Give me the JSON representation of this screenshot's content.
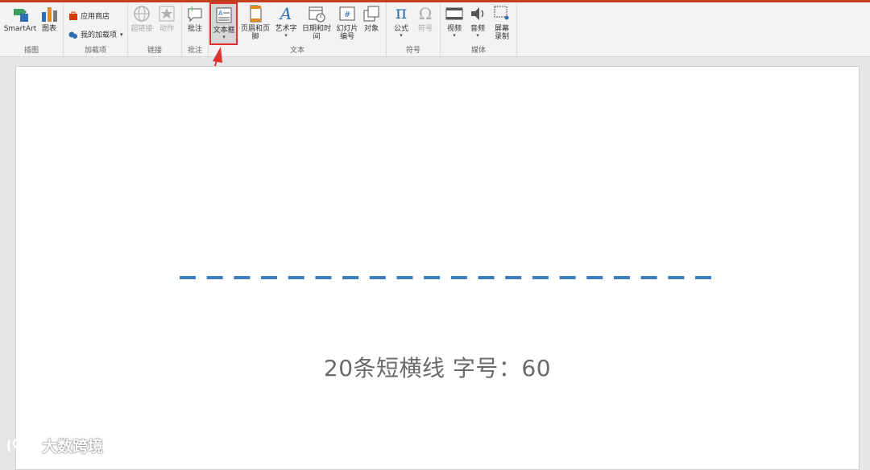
{
  "ribbon": {
    "groups": {
      "illustrations": {
        "label": "插图",
        "smartart": "SmartArt",
        "chart": "图表"
      },
      "addins": {
        "label": "加载项",
        "store": "应用商店",
        "my_addins": "我的加载项"
      },
      "links": {
        "label": "链接",
        "hyperlink": "超链接",
        "action": "动作"
      },
      "comments": {
        "label": "批注",
        "comment": "批注"
      },
      "text": {
        "label": "文本",
        "textbox": "文本框",
        "header_footer": "页眉和页脚",
        "wordart": "艺术字",
        "datetime": "日期和时间",
        "slide_number_1": "幻灯片",
        "slide_number_2": "编号",
        "object": "对象"
      },
      "symbols": {
        "label": "符号",
        "equation": "公式",
        "symbol": "符号"
      },
      "media": {
        "label": "媒体",
        "video": "视频",
        "audio": "音频",
        "screen_rec_1": "屏幕",
        "screen_rec_2": "录制"
      }
    }
  },
  "slide": {
    "caption": "20条短横线  字号：60",
    "dash_count": 20,
    "dash_color": "#3b7bbf"
  },
  "watermark": {
    "text": "大数跨境"
  },
  "colors": {
    "accent_bar": "#c43e1c",
    "highlight": "#e03131"
  }
}
